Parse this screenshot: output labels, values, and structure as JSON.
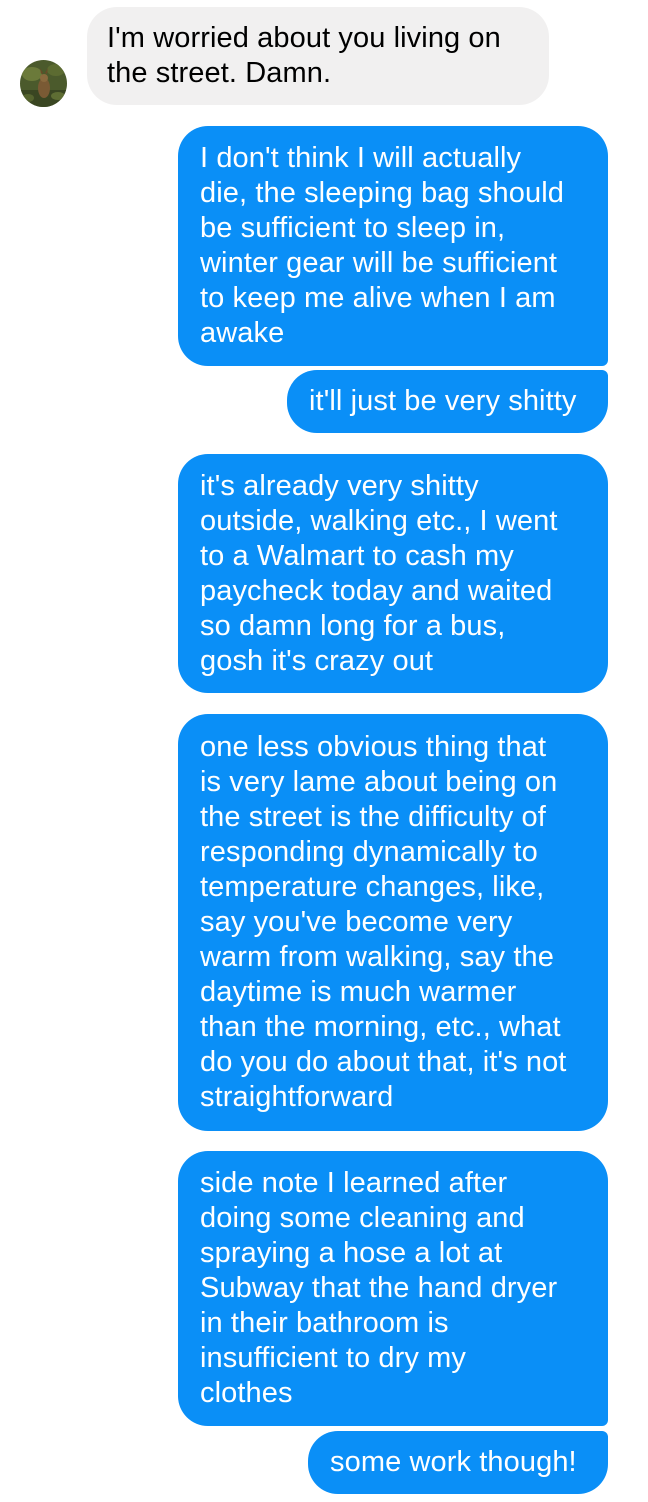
{
  "conversation": {
    "contact": {
      "avatar_icon": "contact-avatar-photo"
    },
    "colors": {
      "incoming_bubble": "#f1f0f0",
      "outgoing_bubble": "#0a8ff7",
      "incoming_text": "#000000",
      "outgoing_text": "#ffffff"
    },
    "messages": [
      {
        "sender": "contact",
        "text": "I'm worried about you living on\nthe street. Damn."
      },
      {
        "sender": "me",
        "text": "I don't think I will actually\ndie, the sleeping bag should\nbe sufficient to sleep in,\nwinter gear will be sufficient\nto keep me alive when I am\nawake"
      },
      {
        "sender": "me",
        "text": "it'll just be very shitty"
      },
      {
        "sender": "me",
        "text": "it's already very shitty\noutside, walking etc., I went\nto a Walmart to cash my\npaycheck today and waited\nso damn long for a bus,\ngosh it's crazy out"
      },
      {
        "sender": "me",
        "text": "one less obvious thing that\nis very lame about being on\nthe street is the difficulty of\nresponding dynamically to\ntemperature changes, like,\nsay you've become very\nwarm from walking, say the\ndaytime is much warmer\nthan the morning, etc., what\ndo you do about that, it's not\nstraightforward"
      },
      {
        "sender": "me",
        "text": "side note I learned after\ndoing some cleaning and\nspraying a hose a lot at\nSubway that the hand dryer\nin their bathroom is\ninsufficient to dry my\nclothes"
      },
      {
        "sender": "me",
        "text": "some work though!"
      }
    ]
  }
}
